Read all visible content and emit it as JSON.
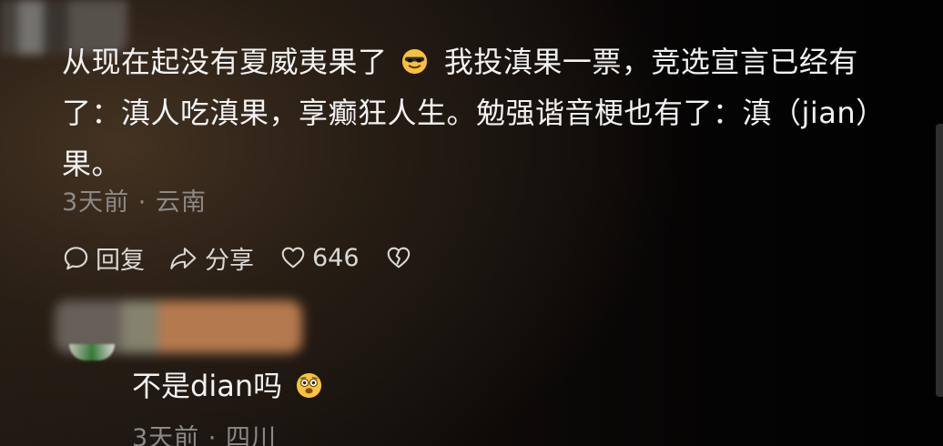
{
  "comment": {
    "text_part1": "从现在起没有夏威夷果了",
    "emoji_1": "smiling-face-with-sunglasses-icon",
    "text_part2": "我投滇果一票，竞选宣言已经有了：滇人吃滇果，享癫狂人生。勉强谐音梗也有了：滇（jian）果。",
    "time": "3天前",
    "separator": "·",
    "location": "云南",
    "actions": {
      "reply_label": "回复",
      "share_label": "分享",
      "like_count": "646"
    }
  },
  "reply": {
    "text": "不是dian吗",
    "emoji": "surprised-face-icon",
    "time": "3天前",
    "separator": "·",
    "location": "四川"
  },
  "icons": {
    "reply": "speech-bubble-icon",
    "share": "share-arrow-icon",
    "like": "heart-icon",
    "dislike": "broken-heart-icon"
  },
  "colors": {
    "text_primary": "#f2f2f2",
    "text_secondary": "#8c8a87",
    "background_dark": "#050404",
    "emoji_yellow": "#f6c43d"
  }
}
